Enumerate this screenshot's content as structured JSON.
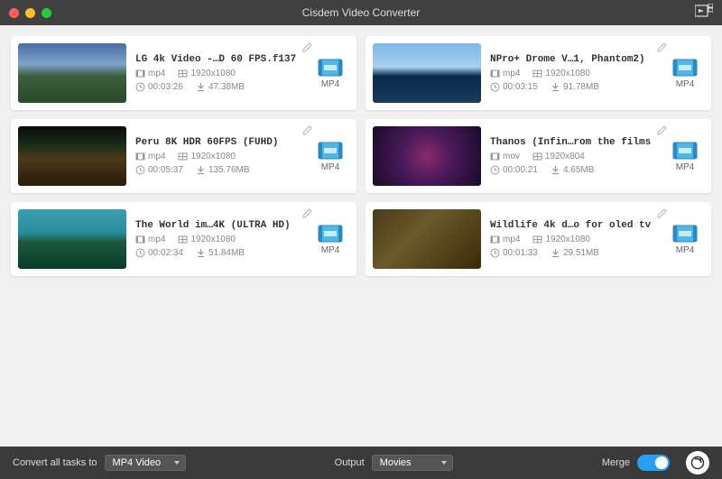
{
  "app": {
    "title": "Cisdem Video Converter"
  },
  "videos": [
    {
      "title": "LG 4k Video -…D 60 FPS.f137",
      "format": "mp4",
      "resolution": "1920x1080",
      "duration": "00:03:26",
      "size": "47.38MB",
      "out": "MP4"
    },
    {
      "title": "NPro+ Drome V…1, Phantom2)",
      "format": "mp4",
      "resolution": "1920x1080",
      "duration": "00:03:15",
      "size": "91.78MB",
      "out": "MP4"
    },
    {
      "title": "Peru 8K HDR 60FPS (FUHD)",
      "format": "mp4",
      "resolution": "1920x1080",
      "duration": "00:05:37",
      "size": "135.76MB",
      "out": "MP4"
    },
    {
      "title": "Thanos (Infin…rom the films",
      "format": "mov",
      "resolution": "1920x804",
      "duration": "00:00:21",
      "size": "4.65MB",
      "out": "MP4"
    },
    {
      "title": "The World im…4K (ULTRA HD)",
      "format": "mp4",
      "resolution": "1920x1080",
      "duration": "00:02:34",
      "size": "51.84MB",
      "out": "MP4"
    },
    {
      "title": "Wildlife 4k d…o for oled tv",
      "format": "mp4",
      "resolution": "1920x1080",
      "duration": "00:01:33",
      "size": "29.51MB",
      "out": "MP4"
    }
  ],
  "footer": {
    "convert_label": "Convert all tasks to",
    "convert_value": "MP4 Video",
    "output_label": "Output",
    "output_value": "Movies",
    "merge_label": "Merge"
  }
}
